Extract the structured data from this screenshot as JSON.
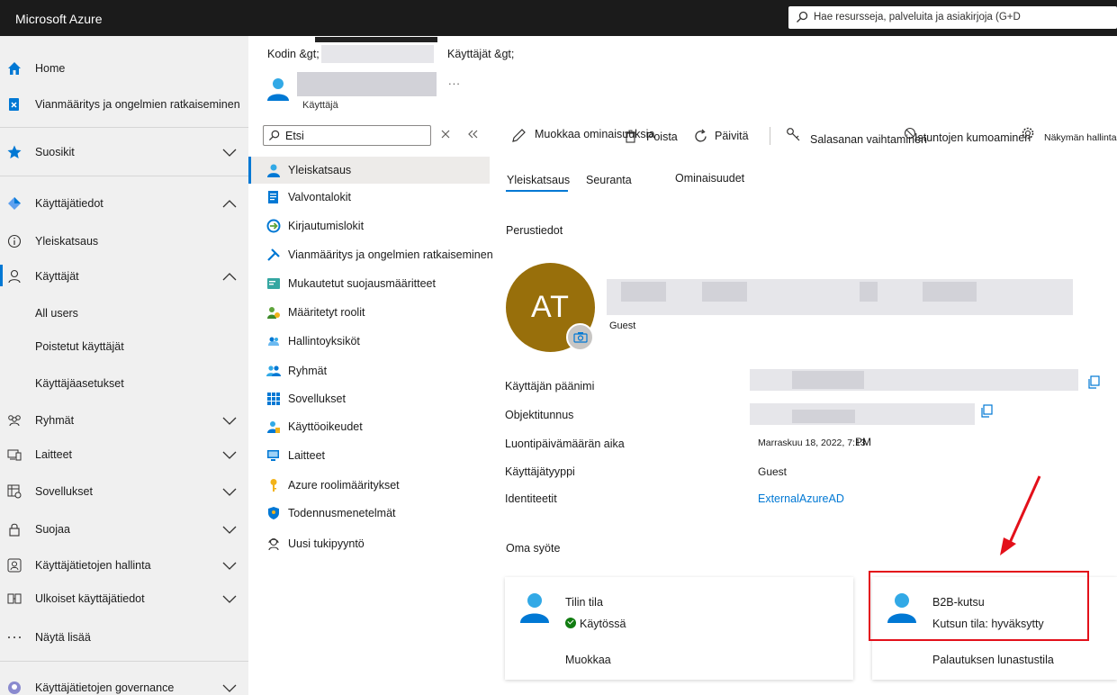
{
  "app": {
    "title": "Microsoft Azure"
  },
  "search": {
    "placeholder": "Hae resursseja, palveluita ja asiakirjoja (G+D"
  },
  "leftnav": {
    "items": [
      {
        "label": "Home"
      },
      {
        "label": "Vianmääritys ja ongelmien ratkaiseminen"
      },
      {
        "label": "Suosikit"
      },
      {
        "label": "Käyttäjätiedot"
      },
      {
        "label": "Yleiskatsaus"
      },
      {
        "label": "Käyttäjät"
      },
      {
        "label": "All users"
      },
      {
        "label": "Poistetut käyttäjät"
      },
      {
        "label": "Käyttäjäasetukset"
      },
      {
        "label": "Ryhmät"
      },
      {
        "label": "Laitteet"
      },
      {
        "label": "Sovellukset"
      },
      {
        "label": "Suojaa"
      },
      {
        "label": "Käyttäjätietojen hallinta"
      },
      {
        "label": "Ulkoiset käyttäjätiedot"
      },
      {
        "label": "Näytä lisää"
      },
      {
        "label": "Käyttäjätietojen governance"
      }
    ]
  },
  "breadcrumb": {
    "home": "Kodin &gt;",
    "users": "Käyttäjät &gt;"
  },
  "header": {
    "subtitle": "Käyttäjä",
    "more": "..."
  },
  "menu": {
    "search_value": "Etsi",
    "items": [
      {
        "label": "Yleiskatsaus"
      },
      {
        "label": "Valvontalokit"
      },
      {
        "label": "Kirjautumislokit"
      },
      {
        "label": "Vianmääritys ja ongelmien ratkaiseminen"
      },
      {
        "label": "Mukautetut suojausmääritteet"
      },
      {
        "label": "Määritetyt roolit"
      },
      {
        "label": "Hallintoyksiköt"
      },
      {
        "label": "Ryhmät"
      },
      {
        "label": "Sovellukset"
      },
      {
        "label": "Käyttöoikeudet"
      },
      {
        "label": "Laitteet"
      },
      {
        "label": "Azure roolimääritykset"
      },
      {
        "label": "Todennusmenetelmät"
      },
      {
        "label": "Uusi tukipyyntö"
      }
    ]
  },
  "toolbar": {
    "edit": "Muokkaa ominaisuuksia",
    "delete": "Poista",
    "refresh": "Päivitä",
    "reset_password": "Salasanan vaihtaminen",
    "revoke_sessions": "Istuntojen kumoaminen",
    "manage_view": "Näkymän hallinta"
  },
  "tabs": {
    "overview": "Yleiskatsaus",
    "monitoring": "Seuranta",
    "properties": "Ominaisuudet"
  },
  "basic_info": {
    "title": "Perustiedot",
    "initials": "AT",
    "user_type_badge": "Guest"
  },
  "properties": {
    "upn_label": "Käyttäjän päänimi",
    "object_id_label": "Objektitunnus",
    "created_label": "Luontipäivämäärän aika",
    "created_value": "Marraskuu 18, 2022, 7:13",
    "created_suffix": "PM",
    "user_type_label": "Käyttäjätyyppi",
    "user_type_value": "Guest",
    "identities_label": "Identiteetit",
    "identities_value": "ExternalAzureAD"
  },
  "feed": {
    "title": "Oma syöte",
    "account_card": {
      "title": "Tilin tila",
      "status": "Käytössä",
      "action": "Muokkaa"
    },
    "b2b_card": {
      "title": "B2B-kutsu",
      "status": "Kutsun tila: hyväksytty",
      "action": "Palautuksen lunastustila"
    }
  },
  "colors": {
    "accent": "#0078d4",
    "avatar": "#986f0b",
    "highlight": "#e3101a",
    "topbar": "#1b1b1b",
    "success": "#107c10"
  }
}
